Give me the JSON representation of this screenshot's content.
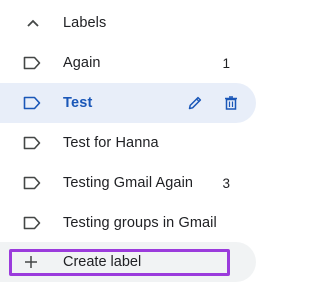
{
  "header": {
    "title": "Labels",
    "toggle_icon": "chevron-up-icon"
  },
  "labels": [
    {
      "name": "Again",
      "count": "1",
      "icon": "label-icon"
    },
    {
      "name": "Test",
      "count": "",
      "icon": "label-icon",
      "active": true
    },
    {
      "name": "Test for Hanna",
      "count": "",
      "icon": "label-icon"
    },
    {
      "name": "Testing Gmail Again",
      "count": "3",
      "icon": "label-icon"
    },
    {
      "name": "Testing groups in Gmail",
      "count": "",
      "icon": "label-icon"
    }
  ],
  "active_actions": {
    "edit_icon": "pencil-icon",
    "delete_icon": "trash-icon"
  },
  "create": {
    "label": "Create label",
    "icon": "plus-icon"
  },
  "colors": {
    "active_bg": "#e8eef9",
    "active_text": "#1a57b8",
    "highlight_outline": "#9b3bdc",
    "create_bg": "#f1f3f4"
  }
}
